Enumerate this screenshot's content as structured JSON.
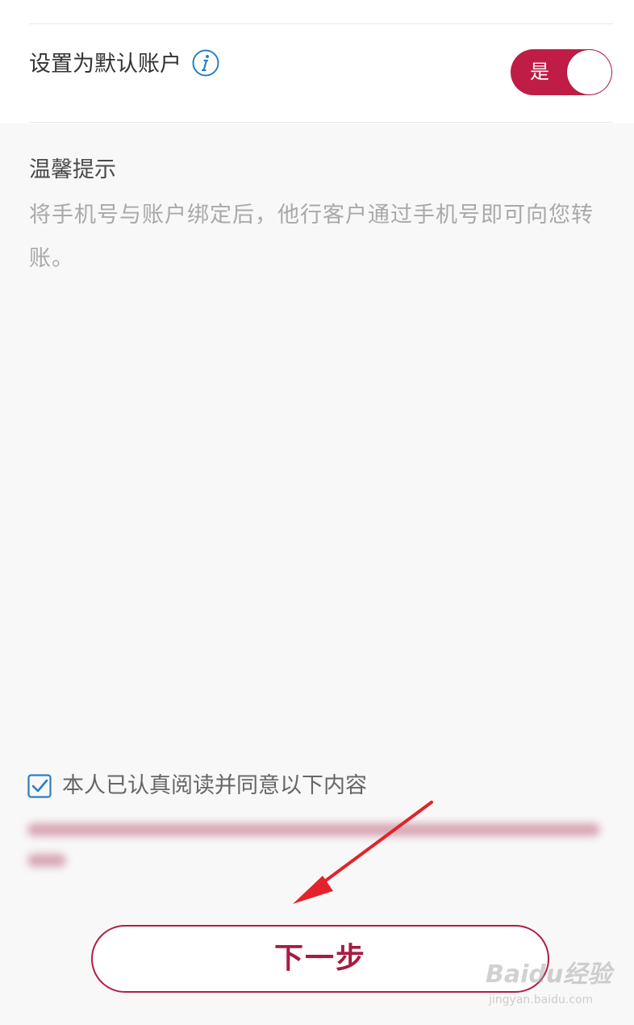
{
  "default_account": {
    "label": "设置为默认账户",
    "info_icon": "info-icon",
    "toggle_text": "是",
    "toggle_on": true,
    "toggle_color": "#bf1d46"
  },
  "tips": {
    "title": "温馨提示",
    "body": "将手机号与账户绑定后，他行客户通过手机号即可向您转账。"
  },
  "agreement": {
    "checked": true,
    "checkbox_icon": "checkbox-checked-icon",
    "label": "本人已认真阅读并同意以下内容"
  },
  "next_button": {
    "label": "下一步",
    "color": "#b41c45"
  },
  "annotation": {
    "icon": "red-arrow-icon",
    "color": "#e2232b"
  },
  "watermark": {
    "main": "Baidu经验",
    "sub": "jingyan.baidu.com"
  }
}
